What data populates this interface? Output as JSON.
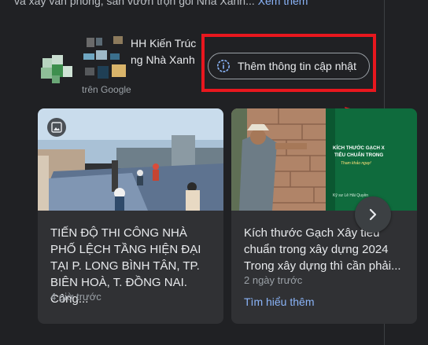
{
  "top_snippet": {
    "text": "và xây văn phòng, sân vườn trọn gói Nhà Xanh...",
    "more_link": "Xem thêm"
  },
  "business": {
    "name_line1": "HH Kiến Trúc",
    "name_line2": "ng Nhà Xanh",
    "source": "trên Google"
  },
  "update_button": {
    "label": "Thêm thông tin cập nhật",
    "icon": "info-icon"
  },
  "posts": [
    {
      "title": "TIẾN ĐỘ THI CÔNG NHÀ PHỐ LỆCH TẦNG HIỆN ĐẠI TẠI P. LONG BÌNH TÂN, TP. BIÊN HOÀ, T. ĐỒNG NAI. Công...",
      "time": "4 giờ trước",
      "badge_icon": "photo-icon"
    },
    {
      "title": "Kích thước Gạch Xây tiêu chuẩn trong xây dựng 2024 Trong xây dựng thì cần phải...",
      "time": "2 ngày trước",
      "link": "Tìm hiểu thêm",
      "overlay_text": {
        "heading": "KÍCH THƯỚC GẠCH X TIÊU CHUẨN TRONG",
        "sub": "Tham khảo ngay!",
        "author": "Kỹ sư Lê Hải Quyền"
      }
    }
  ],
  "next_button_icon": "chevron-right-icon",
  "colors": {
    "background": "#202124",
    "card": "#303134",
    "link": "#8ab4f8",
    "highlight": "#e8171e"
  }
}
